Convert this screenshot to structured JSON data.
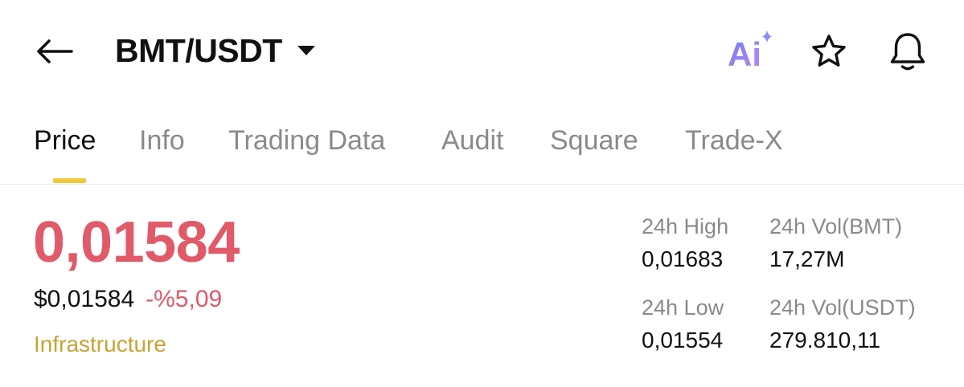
{
  "header": {
    "pair": "BMT/USDT",
    "icons": {
      "back": "arrow-left-icon",
      "dropdown": "caret-down-icon",
      "ai": "ai-sparkle-icon",
      "favorite": "star-icon",
      "alert": "bell-icon"
    },
    "ai_label": "Ai",
    "ai_gradient": [
      "#6f7ff0",
      "#c188f0"
    ]
  },
  "tabs": [
    {
      "label": "Price",
      "active": true
    },
    {
      "label": "Info",
      "active": false
    },
    {
      "label": "Trading Data",
      "active": false
    },
    {
      "label": "Audit",
      "active": false
    },
    {
      "label": "Square",
      "active": false
    },
    {
      "label": "Trade-X",
      "active": false
    }
  ],
  "price": {
    "last": "0,01584",
    "usd": "$0,01584",
    "change_pct": "-%5,09",
    "category": "Infrastructure"
  },
  "stats": {
    "high": {
      "label": "24h High",
      "value": "0,01683"
    },
    "low": {
      "label": "24h Low",
      "value": "0,01554"
    },
    "vol_base": {
      "label": "24h Vol(BMT)",
      "value": "17,27M"
    },
    "vol_quote": {
      "label": "24h Vol(USDT)",
      "value": "279.810,11"
    }
  },
  "colors": {
    "down": "#e05a6a",
    "accent": "#f0c93a",
    "category": "#c9a236",
    "muted": "#8a8a8a"
  }
}
